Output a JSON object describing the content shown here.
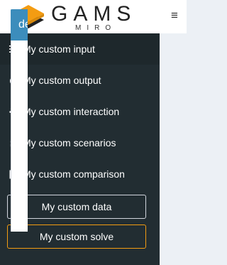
{
  "header": {
    "logo_text": "GAMS",
    "logo_subtext": "MIRO",
    "menu_toggle": "≡"
  },
  "sidebar": {
    "items": [
      {
        "label": "My custom input",
        "icon": "sliders-icon"
      },
      {
        "label": "My custom output",
        "icon": "pie-chart-icon"
      },
      {
        "label": "My custom interaction",
        "icon": "gear-icon"
      },
      {
        "label": "My custom scenarios",
        "icon": "database-icon"
      },
      {
        "label": "My custom comparison",
        "icon": "columns-icon"
      }
    ],
    "data_button": "My custom data",
    "solve_button": "My custom solve"
  },
  "content": {
    "box_title": "de"
  },
  "colors": {
    "sidebar_bg": "#222d32",
    "header_bg": "#ffffff",
    "accent_orange": "#f39c12",
    "box_header_blue": "#3c8dbc"
  }
}
